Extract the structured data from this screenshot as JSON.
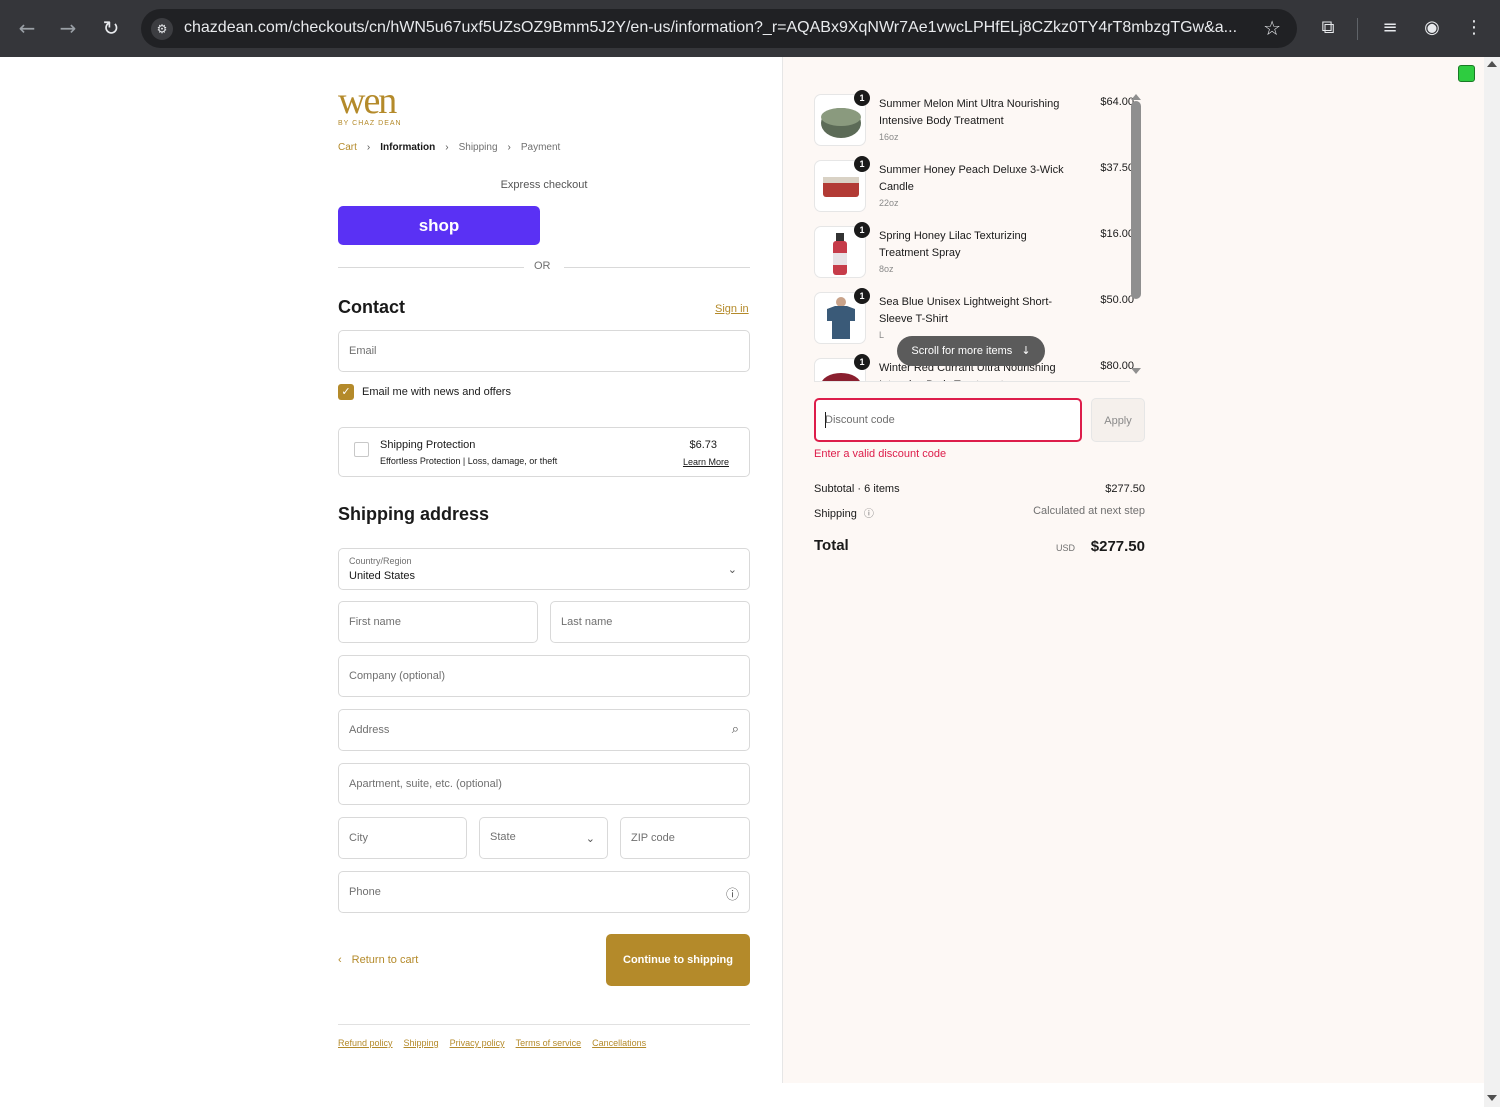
{
  "browser": {
    "url": "chazdean.com/checkouts/cn/hWN5u67uxf5UZsOZ9Bmm5J2Y/en-us/information?_r=AQABx9XqNWr7Ae1vwcLPHfELj8CZkz0TY4rT8mbzgTGw&a...",
    "icons": [
      "back-icon",
      "forward-icon",
      "reload-icon",
      "site-settings-icon",
      "bookmark-star-icon",
      "extensions-icon",
      "reading-list-icon",
      "profile-icon",
      "menu-icon"
    ]
  },
  "brand": {
    "logo_text": "wen",
    "logo_sub": "BY CHAZ DEAN",
    "accent_color": "#b48a2a",
    "shop_color": "#5a31f4"
  },
  "breadcrumb": {
    "cart": "Cart",
    "information": "Information",
    "shipping": "Shipping",
    "payment": "Payment"
  },
  "express": {
    "label": "Express checkout",
    "shop_button": "shop",
    "or": "OR"
  },
  "contact": {
    "title": "Contact",
    "sign_in": "Sign in",
    "email_placeholder": "Email",
    "news_checkbox": "Email me with news and offers",
    "news_checked": true
  },
  "protection": {
    "title": "Shipping Protection",
    "subtitle": "Effortless Protection | Loss, damage, or theft",
    "price": "$6.73",
    "learn_more": "Learn More"
  },
  "shipping_address": {
    "title": "Shipping address",
    "country_label": "Country/Region",
    "country_value": "United States",
    "first_name": "First name",
    "last_name": "Last name",
    "company": "Company (optional)",
    "address": "Address",
    "apartment": "Apartment, suite, etc. (optional)",
    "city": "City",
    "state": "State",
    "zip": "ZIP code",
    "phone": "Phone"
  },
  "actions": {
    "return_to_cart": "Return to cart",
    "continue": "Continue to shipping"
  },
  "footer": [
    "Refund policy",
    "Shipping",
    "Privacy policy",
    "Terms of service",
    "Cancellations"
  ],
  "order": {
    "items": [
      {
        "qty": "1",
        "name": "Summer Melon Mint Ultra Nourishing Intensive Body Treatment",
        "variant": "16oz",
        "price": "$64.00"
      },
      {
        "qty": "1",
        "name": "Summer Honey Peach Deluxe 3-Wick Candle",
        "variant": "22oz",
        "price": "$37.50"
      },
      {
        "qty": "1",
        "name": "Spring Honey Lilac Texturizing Treatment Spray",
        "variant": "8oz",
        "price": "$16.00"
      },
      {
        "qty": "1",
        "name": "Sea Blue Unisex Lightweight Short-Sleeve T-Shirt",
        "variant": "L",
        "price": "$50.00"
      },
      {
        "qty": "1",
        "name": "Winter Red Currant Ultra Nourishing Intensive Body Treatment",
        "variant": "",
        "price": "$80.00"
      }
    ],
    "scroll_hint": "Scroll for more items",
    "discount_placeholder": "Discount code",
    "apply": "Apply",
    "discount_error": "Enter a valid discount code",
    "subtotal_label": "Subtotal · 6 items",
    "subtotal_value": "$277.50",
    "shipping_label": "Shipping",
    "shipping_value": "Calculated at next step",
    "total_label": "Total",
    "currency": "USD",
    "total_value": "$277.50"
  }
}
